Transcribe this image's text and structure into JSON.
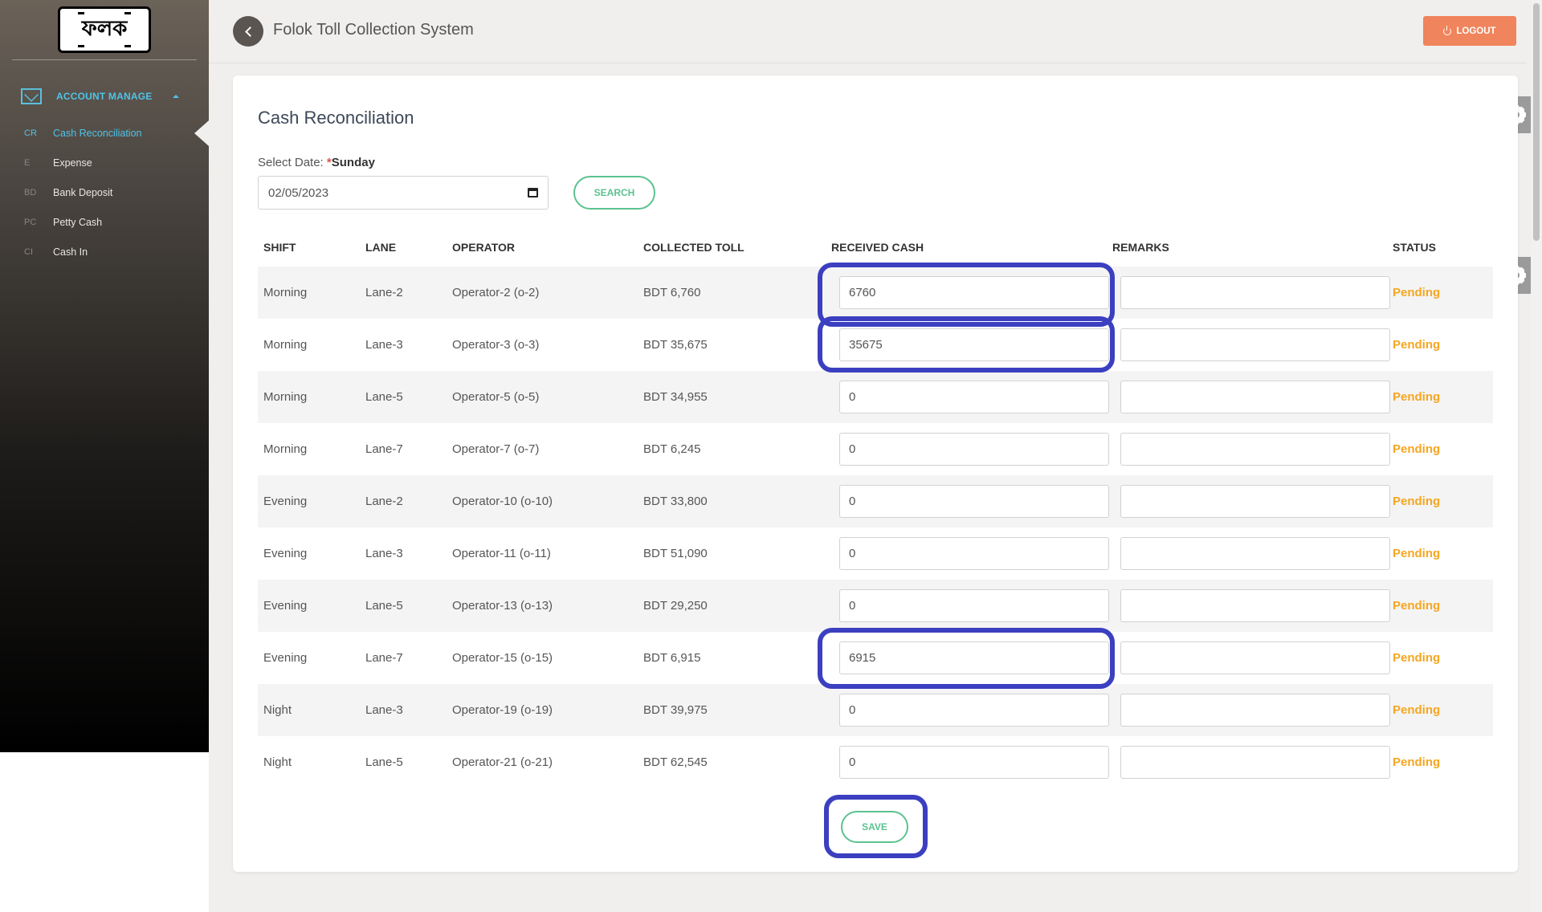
{
  "app": {
    "logo_text": "ফলক",
    "title": "Folok Toll Collection System",
    "logout_label": "LOGOUT"
  },
  "sidebar": {
    "section_label": "ACCOUNT MANAGE",
    "items": [
      {
        "abbr": "CR",
        "label": "Cash Reconciliation",
        "active": true
      },
      {
        "abbr": "E",
        "label": "Expense",
        "active": false
      },
      {
        "abbr": "BD",
        "label": "Bank Deposit",
        "active": false
      },
      {
        "abbr": "PC",
        "label": "Petty Cash",
        "active": false
      },
      {
        "abbr": "CI",
        "label": "Cash In",
        "active": false
      }
    ]
  },
  "page": {
    "title": "Cash Reconciliation",
    "date_label": "Select Date:",
    "date_required_mark": "*",
    "day_name": "Sunday",
    "date_value": "02/05/2023",
    "search_label": "SEARCH",
    "save_label": "SAVE"
  },
  "table": {
    "headers": [
      "SHIFT",
      "LANE",
      "OPERATOR",
      "COLLECTED TOLL",
      "RECEIVED CASH",
      "REMARKS",
      "STATUS"
    ],
    "rows": [
      {
        "shift": "Morning",
        "lane": "Lane-2",
        "operator": "Operator-2 (o-2)",
        "collected": "BDT 6,760",
        "received": "6760",
        "remarks": "",
        "status": "Pending"
      },
      {
        "shift": "Morning",
        "lane": "Lane-3",
        "operator": "Operator-3 (o-3)",
        "collected": "BDT 35,675",
        "received": "35675",
        "remarks": "",
        "status": "Pending"
      },
      {
        "shift": "Morning",
        "lane": "Lane-5",
        "operator": "Operator-5 (o-5)",
        "collected": "BDT 34,955",
        "received": "0",
        "remarks": "",
        "status": "Pending"
      },
      {
        "shift": "Morning",
        "lane": "Lane-7",
        "operator": "Operator-7 (o-7)",
        "collected": "BDT 6,245",
        "received": "0",
        "remarks": "",
        "status": "Pending"
      },
      {
        "shift": "Evening",
        "lane": "Lane-2",
        "operator": "Operator-10 (o-10)",
        "collected": "BDT 33,800",
        "received": "0",
        "remarks": "",
        "status": "Pending"
      },
      {
        "shift": "Evening",
        "lane": "Lane-3",
        "operator": "Operator-11 (o-11)",
        "collected": "BDT 51,090",
        "received": "0",
        "remarks": "",
        "status": "Pending"
      },
      {
        "shift": "Evening",
        "lane": "Lane-5",
        "operator": "Operator-13 (o-13)",
        "collected": "BDT 29,250",
        "received": "0",
        "remarks": "",
        "status": "Pending"
      },
      {
        "shift": "Evening",
        "lane": "Lane-7",
        "operator": "Operator-15 (o-15)",
        "collected": "BDT 6,915",
        "received": "6915",
        "remarks": "",
        "status": "Pending"
      },
      {
        "shift": "Night",
        "lane": "Lane-3",
        "operator": "Operator-19 (o-19)",
        "collected": "BDT 39,975",
        "received": "0",
        "remarks": "",
        "status": "Pending"
      },
      {
        "shift": "Night",
        "lane": "Lane-5",
        "operator": "Operator-21 (o-21)",
        "collected": "BDT 62,545",
        "received": "0",
        "remarks": "",
        "status": "Pending"
      }
    ]
  },
  "colors": {
    "accent": "#4fc3e8",
    "logout": "#f0845c",
    "success": "#5cc28f",
    "pending": "#f5a623",
    "highlight": "#3b3fc0"
  }
}
